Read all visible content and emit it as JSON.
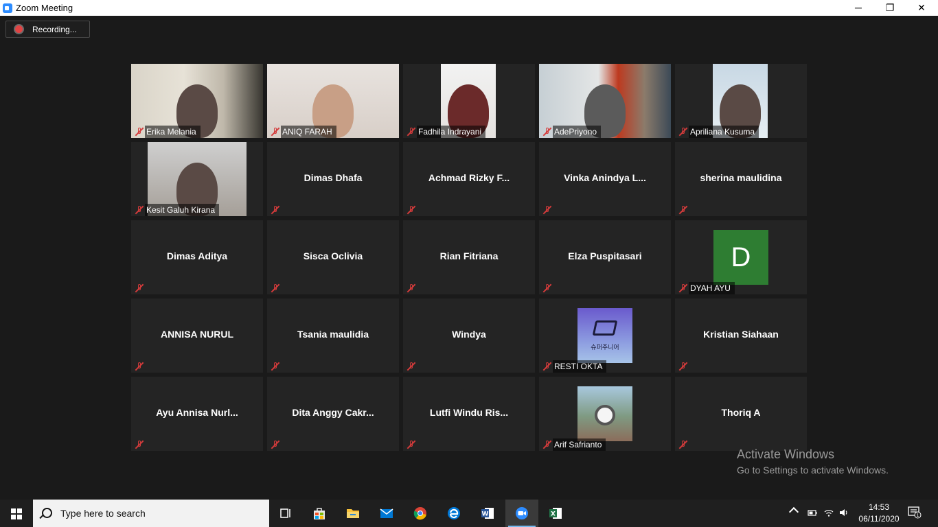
{
  "window": {
    "title": "Zoom Meeting",
    "minimize_glyph": "─",
    "restore_glyph": "❐",
    "close_glyph": "✕"
  },
  "recording": {
    "label": "Recording..."
  },
  "participants": [
    {
      "name": "Erika Melania",
      "video": true,
      "label": true
    },
    {
      "name": "ANIQ FARAH",
      "video": true,
      "label": true
    },
    {
      "name": "Fadhila Indrayani",
      "video": true,
      "label": true
    },
    {
      "name": "AdePriyono",
      "video": true,
      "label": true
    },
    {
      "name": "Apriliana Kusuma",
      "video": true,
      "label": true
    },
    {
      "name": "Kesit Galuh Kirana",
      "video": true,
      "label": true
    },
    {
      "name": "Dimas Dhafa",
      "video": false
    },
    {
      "name": "Achmad Rizky F...",
      "video": false
    },
    {
      "name": "Vinka Anindya L...",
      "video": false
    },
    {
      "name": "sherina maulidina",
      "video": false
    },
    {
      "name": "Dimas Aditya",
      "video": false
    },
    {
      "name": "Sisca Oclivia",
      "video": false
    },
    {
      "name": "Rian Fitriana",
      "video": false
    },
    {
      "name": "Elza Puspitasari",
      "video": false
    },
    {
      "name": "DYAH AYU",
      "video": false,
      "label": true,
      "avatar_letter": "D",
      "avatar_color": "#2e7d32"
    },
    {
      "name": "ANNISA NURUL",
      "video": false
    },
    {
      "name": "Tsania maulidia",
      "video": false
    },
    {
      "name": "Windya",
      "video": false
    },
    {
      "name": "RESTI OKTA",
      "video": false,
      "label": true,
      "avatar_image": "logo"
    },
    {
      "name": "Kristian Siahaan",
      "video": false
    },
    {
      "name": "Ayu Annisa Nurl...",
      "video": false
    },
    {
      "name": "Dita Anggy Cakr...",
      "video": false
    },
    {
      "name": "Lutfi Windu Ris...",
      "video": false
    },
    {
      "name": "Arif Safrianto",
      "video": false,
      "label": true,
      "avatar_image": "watch"
    },
    {
      "name": "Thoriq A",
      "video": false
    }
  ],
  "logo_avatar_text": "슈퍼주니어",
  "watermark": {
    "title": "Activate Windows",
    "subtitle": "Go to Settings to activate Windows."
  },
  "taskbar": {
    "search_placeholder": "Type here to search",
    "apps": [
      "task-view",
      "microsoft-store",
      "file-explorer",
      "mail",
      "chrome",
      "edge",
      "word",
      "zoom",
      "excel"
    ],
    "active_app": "zoom",
    "time": "14:53",
    "date": "06/11/2020",
    "notification_count": "1"
  }
}
